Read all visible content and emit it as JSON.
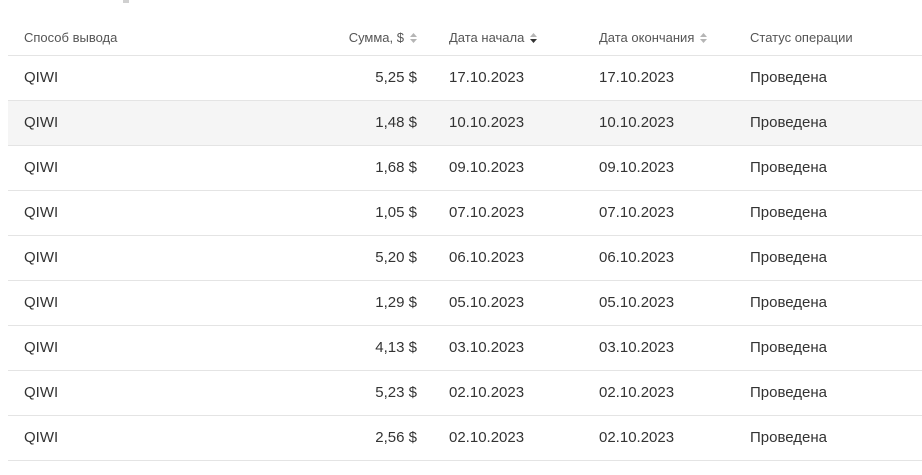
{
  "table": {
    "headers": {
      "method": "Способ вывода",
      "amount": "Сумма, $",
      "start_date": "Дата начала",
      "end_date": "Дата окончания",
      "status": "Статус операции"
    },
    "sort": {
      "amount": "none",
      "start_date": "descending",
      "end_date": "none"
    },
    "rows": [
      {
        "method": "QIWI",
        "amount": "5,25 $",
        "start": "17.10.2023",
        "end": "17.10.2023",
        "status": "Проведена"
      },
      {
        "method": "QIWI",
        "amount": "1,48 $",
        "start": "10.10.2023",
        "end": "10.10.2023",
        "status": "Проведена"
      },
      {
        "method": "QIWI",
        "amount": "1,68 $",
        "start": "09.10.2023",
        "end": "09.10.2023",
        "status": "Проведена"
      },
      {
        "method": "QIWI",
        "amount": "1,05 $",
        "start": "07.10.2023",
        "end": "07.10.2023",
        "status": "Проведена"
      },
      {
        "method": "QIWI",
        "amount": "5,20 $",
        "start": "06.10.2023",
        "end": "06.10.2023",
        "status": "Проведена"
      },
      {
        "method": "QIWI",
        "amount": "1,29 $",
        "start": "05.10.2023",
        "end": "05.10.2023",
        "status": "Проведена"
      },
      {
        "method": "QIWI",
        "amount": "4,13 $",
        "start": "03.10.2023",
        "end": "03.10.2023",
        "status": "Проведена"
      },
      {
        "method": "QIWI",
        "amount": "5,23 $",
        "start": "02.10.2023",
        "end": "02.10.2023",
        "status": "Проведена"
      },
      {
        "method": "QIWI",
        "amount": "2,56 $",
        "start": "02.10.2023",
        "end": "02.10.2023",
        "status": "Проведена"
      }
    ]
  },
  "colors": {
    "row_hover": "#f5f5f5",
    "border": "#e4e4e4",
    "text": "#333333",
    "header_text": "#555555"
  }
}
